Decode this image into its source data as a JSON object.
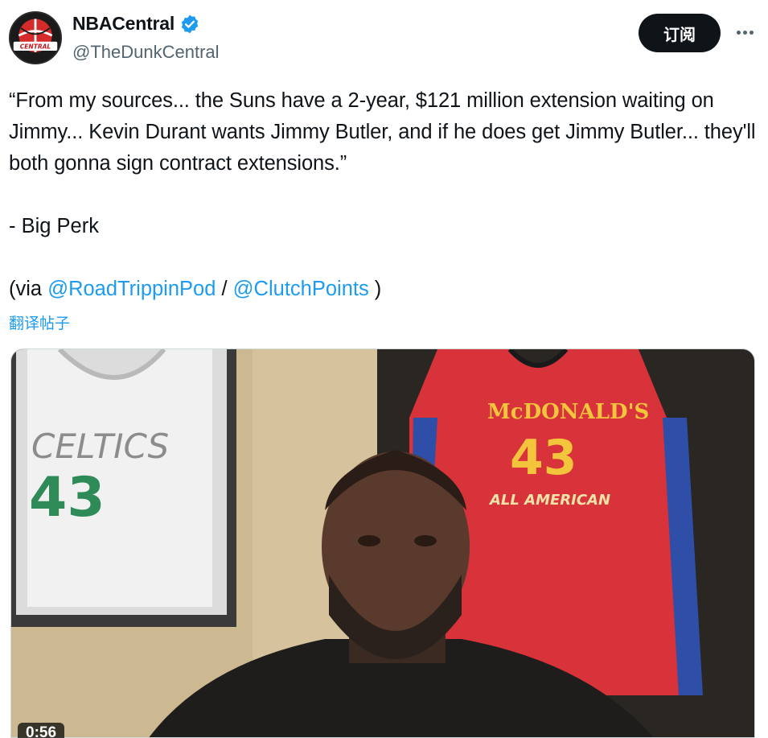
{
  "author": {
    "display_name": "NBACentral",
    "handle": "@TheDunkCentral",
    "avatar_text": "CENTRAL",
    "verified_icon": "verified-badge-icon",
    "verified_color": "#1d9bf0"
  },
  "actions": {
    "subscribe_label": "订阅",
    "more_icon": "more-dots-icon"
  },
  "tweet": {
    "quote_text": "“From my sources... the Suns have a 2-year, $121 million extension waiting on Jimmy... Kevin Durant wants Jimmy Butler, and if he does get Jimmy Butler... they'll both gonna sign contract extensions.”",
    "attribution": "- Big Perk",
    "via_prefix": "(via ",
    "via_link_1": "@RoadTrippinPod",
    "via_separator": " / ",
    "via_link_2": "@ClutchPoints",
    "via_suffix": " )",
    "translate_label": "翻译帖子"
  },
  "media": {
    "type": "video",
    "duration": "0:56",
    "jersey_left_team": "CELTICS",
    "jersey_left_number": "43",
    "jersey_right_brand": "McDONALD'S",
    "jersey_right_number": "43",
    "jersey_right_caption": "ALL AMERICAN"
  },
  "colors": {
    "link": "#1d9bf0",
    "text": "#0f1419",
    "secondary": "#536471",
    "button_bg": "#0f1419"
  }
}
